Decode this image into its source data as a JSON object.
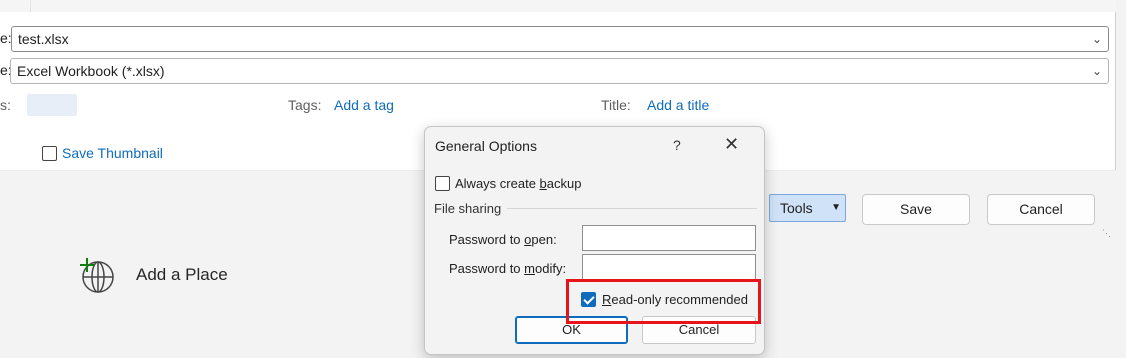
{
  "save_as": {
    "filename_label_edge": "e:",
    "filename_value": "test.xlsx",
    "type_label_edge": "e:",
    "type_value": "Excel Workbook (*.xlsx)",
    "authors_label_edge": "s:",
    "tags_label": "Tags:",
    "tags_link": "Add a tag",
    "title_label": "Title:",
    "title_link": "Add a title",
    "save_thumbnail_label": "Save Thumbnail",
    "save_thumbnail_checked": false,
    "tools_label": "Tools",
    "save_label": "Save",
    "cancel_label": "Cancel"
  },
  "backstage": {
    "add_place_label": "Add a Place"
  },
  "general_options": {
    "title": "General Options",
    "help_glyph": "?",
    "close_glyph": "✕",
    "always_backup_pre": "Always create ",
    "always_backup_acc": "b",
    "always_backup_post": "ackup",
    "always_backup_checked": false,
    "file_sharing_label": "File sharing",
    "password_open_pre": "Password to ",
    "password_open_acc": "o",
    "password_open_post": "pen:",
    "password_modify_pre": "Password to ",
    "password_modify_acc": "m",
    "password_modify_post": "odify:",
    "password_open_value": "",
    "password_modify_value": "",
    "readonly_acc": "R",
    "readonly_post": "ead-only recommended",
    "readonly_checked": true,
    "ok_label": "OK",
    "cancel_label": "Cancel"
  },
  "colors": {
    "accent": "#0f6cbd",
    "highlight": "#e8141b",
    "tools_bg": "#cfe2f8"
  }
}
